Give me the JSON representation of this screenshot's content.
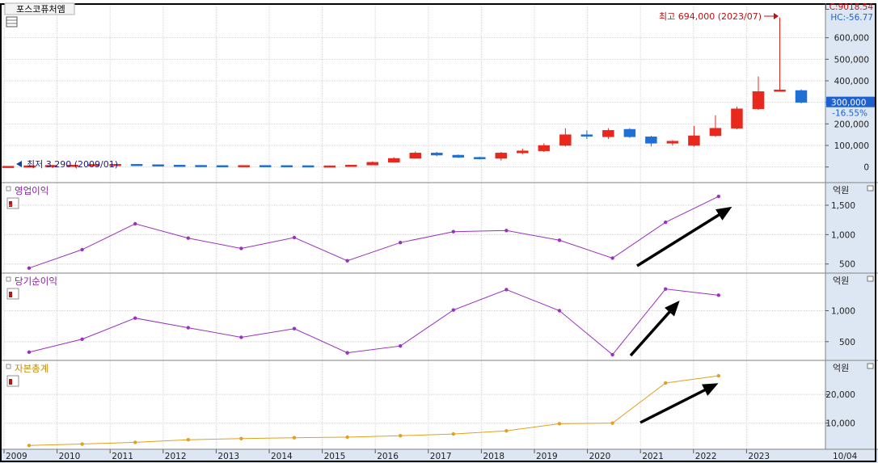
{
  "stock_name": "포스코퓨처엠",
  "top_right_lc": "LC:9018.54",
  "top_right_hc": "HC:-56.77",
  "colors": {
    "up": "#e8281c",
    "down": "#1f6fd4",
    "op_line": "#9b30c0",
    "net_line": "#9b30c0",
    "equity_line": "#e0a020",
    "arrow": "#000000",
    "axis_bg": "#dde7f3"
  },
  "chart_data": [
    {
      "type": "candlestick",
      "title": "포스코퓨처엠",
      "unit": "monthly",
      "x_ticks": [
        "2009",
        "2010",
        "2011",
        "2012",
        "2013",
        "2014",
        "2015",
        "2016",
        "2017",
        "2018",
        "2019",
        "2020",
        "2021",
        "2022",
        "2023"
      ],
      "bottom_right_label": "10/04",
      "y_ticks": [
        0,
        100000,
        200000,
        300000,
        400000,
        500000,
        600000
      ],
      "y_tick_labels": [
        "0",
        "100,000",
        "200,000",
        "300,000",
        "400,000",
        "500,000",
        "600,000"
      ],
      "ylim": [
        -50000,
        700000
      ],
      "current_price_label": "300,000",
      "current_change_label": "-16.55%",
      "high_annotation": "최고 694,000 (2023/07)",
      "low_annotation": "최저 3,290 (2009/01)",
      "candles": [
        {
          "t": 2009.05,
          "o": 3300,
          "c": 4000,
          "h": 4500,
          "l": 3290
        },
        {
          "t": 2009.55,
          "o": 4000,
          "c": 6000,
          "h": 6500,
          "l": 3800
        },
        {
          "t": 2010.05,
          "o": 6000,
          "c": 8000,
          "h": 8500,
          "l": 5800
        },
        {
          "t": 2010.55,
          "o": 8000,
          "c": 9000,
          "h": 9500,
          "l": 7500
        },
        {
          "t": 2011.05,
          "o": 9000,
          "c": 12000,
          "h": 13000,
          "l": 8500
        },
        {
          "t": 2011.55,
          "o": 12000,
          "c": 13000,
          "h": 14000,
          "l": 11000
        },
        {
          "t": 2012.05,
          "o": 13000,
          "c": 11000,
          "h": 13500,
          "l": 10500
        },
        {
          "t": 2012.55,
          "o": 11000,
          "c": 9000,
          "h": 11500,
          "l": 8500
        },
        {
          "t": 2013.05,
          "o": 9000,
          "c": 8000,
          "h": 9500,
          "l": 7500
        },
        {
          "t": 2013.55,
          "o": 8000,
          "c": 7000,
          "h": 8500,
          "l": 6500
        },
        {
          "t": 2014.05,
          "o": 7000,
          "c": 6500,
          "h": 7500,
          "l": 6000
        },
        {
          "t": 2014.55,
          "o": 6500,
          "c": 7500,
          "h": 8000,
          "l": 6000
        },
        {
          "t": 2015.05,
          "o": 7500,
          "c": 7000,
          "h": 8000,
          "l": 6500
        },
        {
          "t": 2015.55,
          "o": 7000,
          "c": 6500,
          "h": 7500,
          "l": 6000
        },
        {
          "t": 2016.05,
          "o": 6500,
          "c": 5000,
          "h": 7000,
          "l": 4800
        },
        {
          "t": 2016.55,
          "o": 5000,
          "c": 6000,
          "h": 6500,
          "l": 4800
        },
        {
          "t": 2017.05,
          "o": 6000,
          "c": 9000,
          "h": 10000,
          "l": 5800
        },
        {
          "t": 2017.55,
          "o": 9000,
          "c": 22000,
          "h": 26000,
          "l": 8500
        },
        {
          "t": 2018.05,
          "o": 22000,
          "c": 40000,
          "h": 45000,
          "l": 21000
        },
        {
          "t": 2018.55,
          "o": 40000,
          "c": 65000,
          "h": 72000,
          "l": 38000
        },
        {
          "t": 2019.05,
          "o": 65000,
          "c": 55000,
          "h": 70000,
          "l": 50000
        },
        {
          "t": 2019.55,
          "o": 55000,
          "c": 45000,
          "h": 58000,
          "l": 42000
        },
        {
          "t": 2020.05,
          "o": 45000,
          "c": 40000,
          "h": 48000,
          "l": 35000
        },
        {
          "t": 2020.55,
          "o": 40000,
          "c": 65000,
          "h": 70000,
          "l": 30000
        },
        {
          "t": 2021.05,
          "o": 65000,
          "c": 75000,
          "h": 85000,
          "l": 60000
        },
        {
          "t": 2021.55,
          "o": 75000,
          "c": 100000,
          "h": 110000,
          "l": 70000
        },
        {
          "t": 2022.05,
          "o": 100000,
          "c": 150000,
          "h": 180000,
          "l": 95000
        },
        {
          "t": 2022.55,
          "o": 150000,
          "c": 145000,
          "h": 170000,
          "l": 130000
        },
        {
          "t": 2023.05,
          "o": 140000,
          "c": 170000,
          "h": 180000,
          "l": 130000
        },
        {
          "t": 2023.55,
          "o": 175000,
          "c": 140000,
          "h": 180000,
          "l": 135000
        },
        {
          "t": 2024.05,
          "o": 140000,
          "c": 110000,
          "h": 145000,
          "l": 95000
        },
        {
          "t": 2024.55,
          "o": 110000,
          "c": 120000,
          "h": 125000,
          "l": 100000
        },
        {
          "t": 2025.05,
          "o": 100000,
          "c": 145000,
          "h": 190000,
          "l": 95000
        },
        {
          "t": 2025.55,
          "o": 145000,
          "c": 180000,
          "h": 240000,
          "l": 140000
        },
        {
          "t": 2026.05,
          "o": 180000,
          "c": 270000,
          "h": 280000,
          "l": 175000
        },
        {
          "t": 2026.55,
          "o": 270000,
          "c": 350000,
          "h": 420000,
          "l": 265000
        },
        {
          "t": 2027.05,
          "o": 355000,
          "c": 358000,
          "h": 694000,
          "l": 350000
        },
        {
          "t": 2027.55,
          "o": 355000,
          "c": 300000,
          "h": 360000,
          "l": 295000
        }
      ]
    },
    {
      "type": "line",
      "title": "영업이익",
      "unit_label": "억원",
      "y_ticks": [
        500,
        1000,
        1500
      ],
      "y_tick_labels": [
        "500",
        "1,000",
        "1,500"
      ],
      "ylim": [
        400,
        1720
      ],
      "x": [
        2009,
        2010,
        2011,
        2012,
        2013,
        2014,
        2015,
        2016,
        2017,
        2018,
        2019,
        2020,
        2021,
        2022
      ],
      "values": [
        430,
        745,
        1185,
        940,
        765,
        950,
        555,
        865,
        1050,
        1070,
        905,
        600,
        1210,
        1650
      ]
    },
    {
      "type": "line",
      "title": "당기순이익",
      "unit_label": "억원",
      "y_ticks": [
        500,
        1000
      ],
      "y_tick_labels": [
        "500",
        "1,000"
      ],
      "ylim": [
        250,
        1450
      ],
      "x": [
        2009,
        2010,
        2011,
        2012,
        2013,
        2014,
        2015,
        2016,
        2017,
        2018,
        2019,
        2020,
        2021,
        2022
      ],
      "values": [
        330,
        540,
        880,
        725,
        570,
        710,
        320,
        430,
        1010,
        1340,
        1000,
        290,
        1350,
        1250
      ]
    },
    {
      "type": "line",
      "title": "자본총계",
      "unit_label": "억원",
      "y_ticks": [
        10000,
        20000
      ],
      "y_tick_labels": [
        "10,000",
        "20,000"
      ],
      "ylim": [
        2000,
        28500
      ],
      "x": [
        2009,
        2010,
        2011,
        2012,
        2013,
        2014,
        2015,
        2016,
        2017,
        2018,
        2019,
        2020,
        2021,
        2022
      ],
      "values": [
        2200,
        2700,
        3300,
        4200,
        4600,
        4900,
        5100,
        5600,
        6200,
        7300,
        9800,
        10000,
        24000,
        26500
      ]
    }
  ],
  "x_axis_labels": [
    "2009",
    "2010",
    "2011",
    "2012",
    "2013",
    "2014",
    "2015",
    "2016",
    "2017",
    "2018",
    "2019",
    "2020",
    "2021",
    "2022",
    "2023"
  ]
}
